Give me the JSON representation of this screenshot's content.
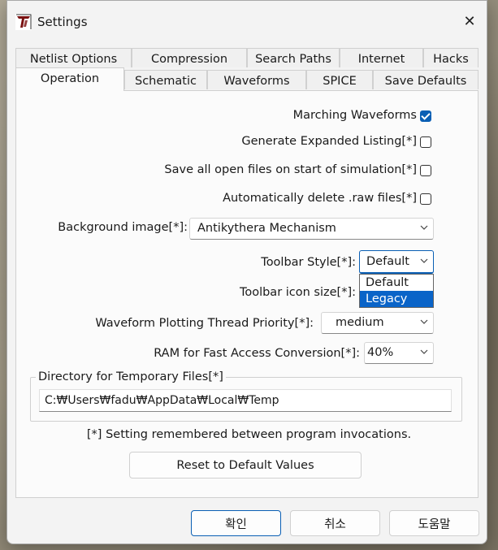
{
  "window": {
    "title": "Settings",
    "app_icon": "ltspice-logo-icon",
    "close_glyph": "✕"
  },
  "tabs": {
    "row_top": [
      "Netlist Options",
      "Compression",
      "Search Paths",
      "Internet",
      "Hacks"
    ],
    "row_bottom": [
      "Operation",
      "Schematic",
      "Waveforms",
      "SPICE",
      "Save Defaults"
    ],
    "active": "Operation"
  },
  "operation": {
    "marching_waveforms": {
      "label": "Marching Waveforms",
      "checked": true
    },
    "generate_expanded_listing": {
      "label": "Generate Expanded Listing[*]",
      "checked": false
    },
    "save_open_files": {
      "label": "Save all open files on start of simulation[*]",
      "checked": false
    },
    "auto_delete_raw": {
      "label": "Automatically delete .raw files[*]",
      "checked": false
    },
    "background_image": {
      "label": "Background image[*]:",
      "value": "Antikythera Mechanism"
    },
    "toolbar_style": {
      "label": "Toolbar Style[*]:",
      "value": "Default",
      "options": [
        "Default",
        "Legacy"
      ],
      "highlighted": "Legacy"
    },
    "toolbar_icon_size": {
      "label": "Toolbar icon size[*]:"
    },
    "waveform_priority": {
      "label": "Waveform Plotting Thread Priority[*]:",
      "value": "medium"
    },
    "ram_fast_access": {
      "label": "RAM for Fast Access Conversion[*]:",
      "value": "40%"
    },
    "temp_dir": {
      "group_title": "Directory for Temporary Files[*]",
      "value": "C:₩Users₩fadu₩AppData₩Local₩Temp"
    },
    "note": "[*] Setting remembered between program invocations.",
    "reset_label": "Reset to Default Values"
  },
  "footer": {
    "ok_label": "확인",
    "cancel_label": "취소",
    "help_label": "도움말"
  },
  "colors": {
    "accent": "#0a5fb4",
    "selection": "#0a64c8"
  }
}
